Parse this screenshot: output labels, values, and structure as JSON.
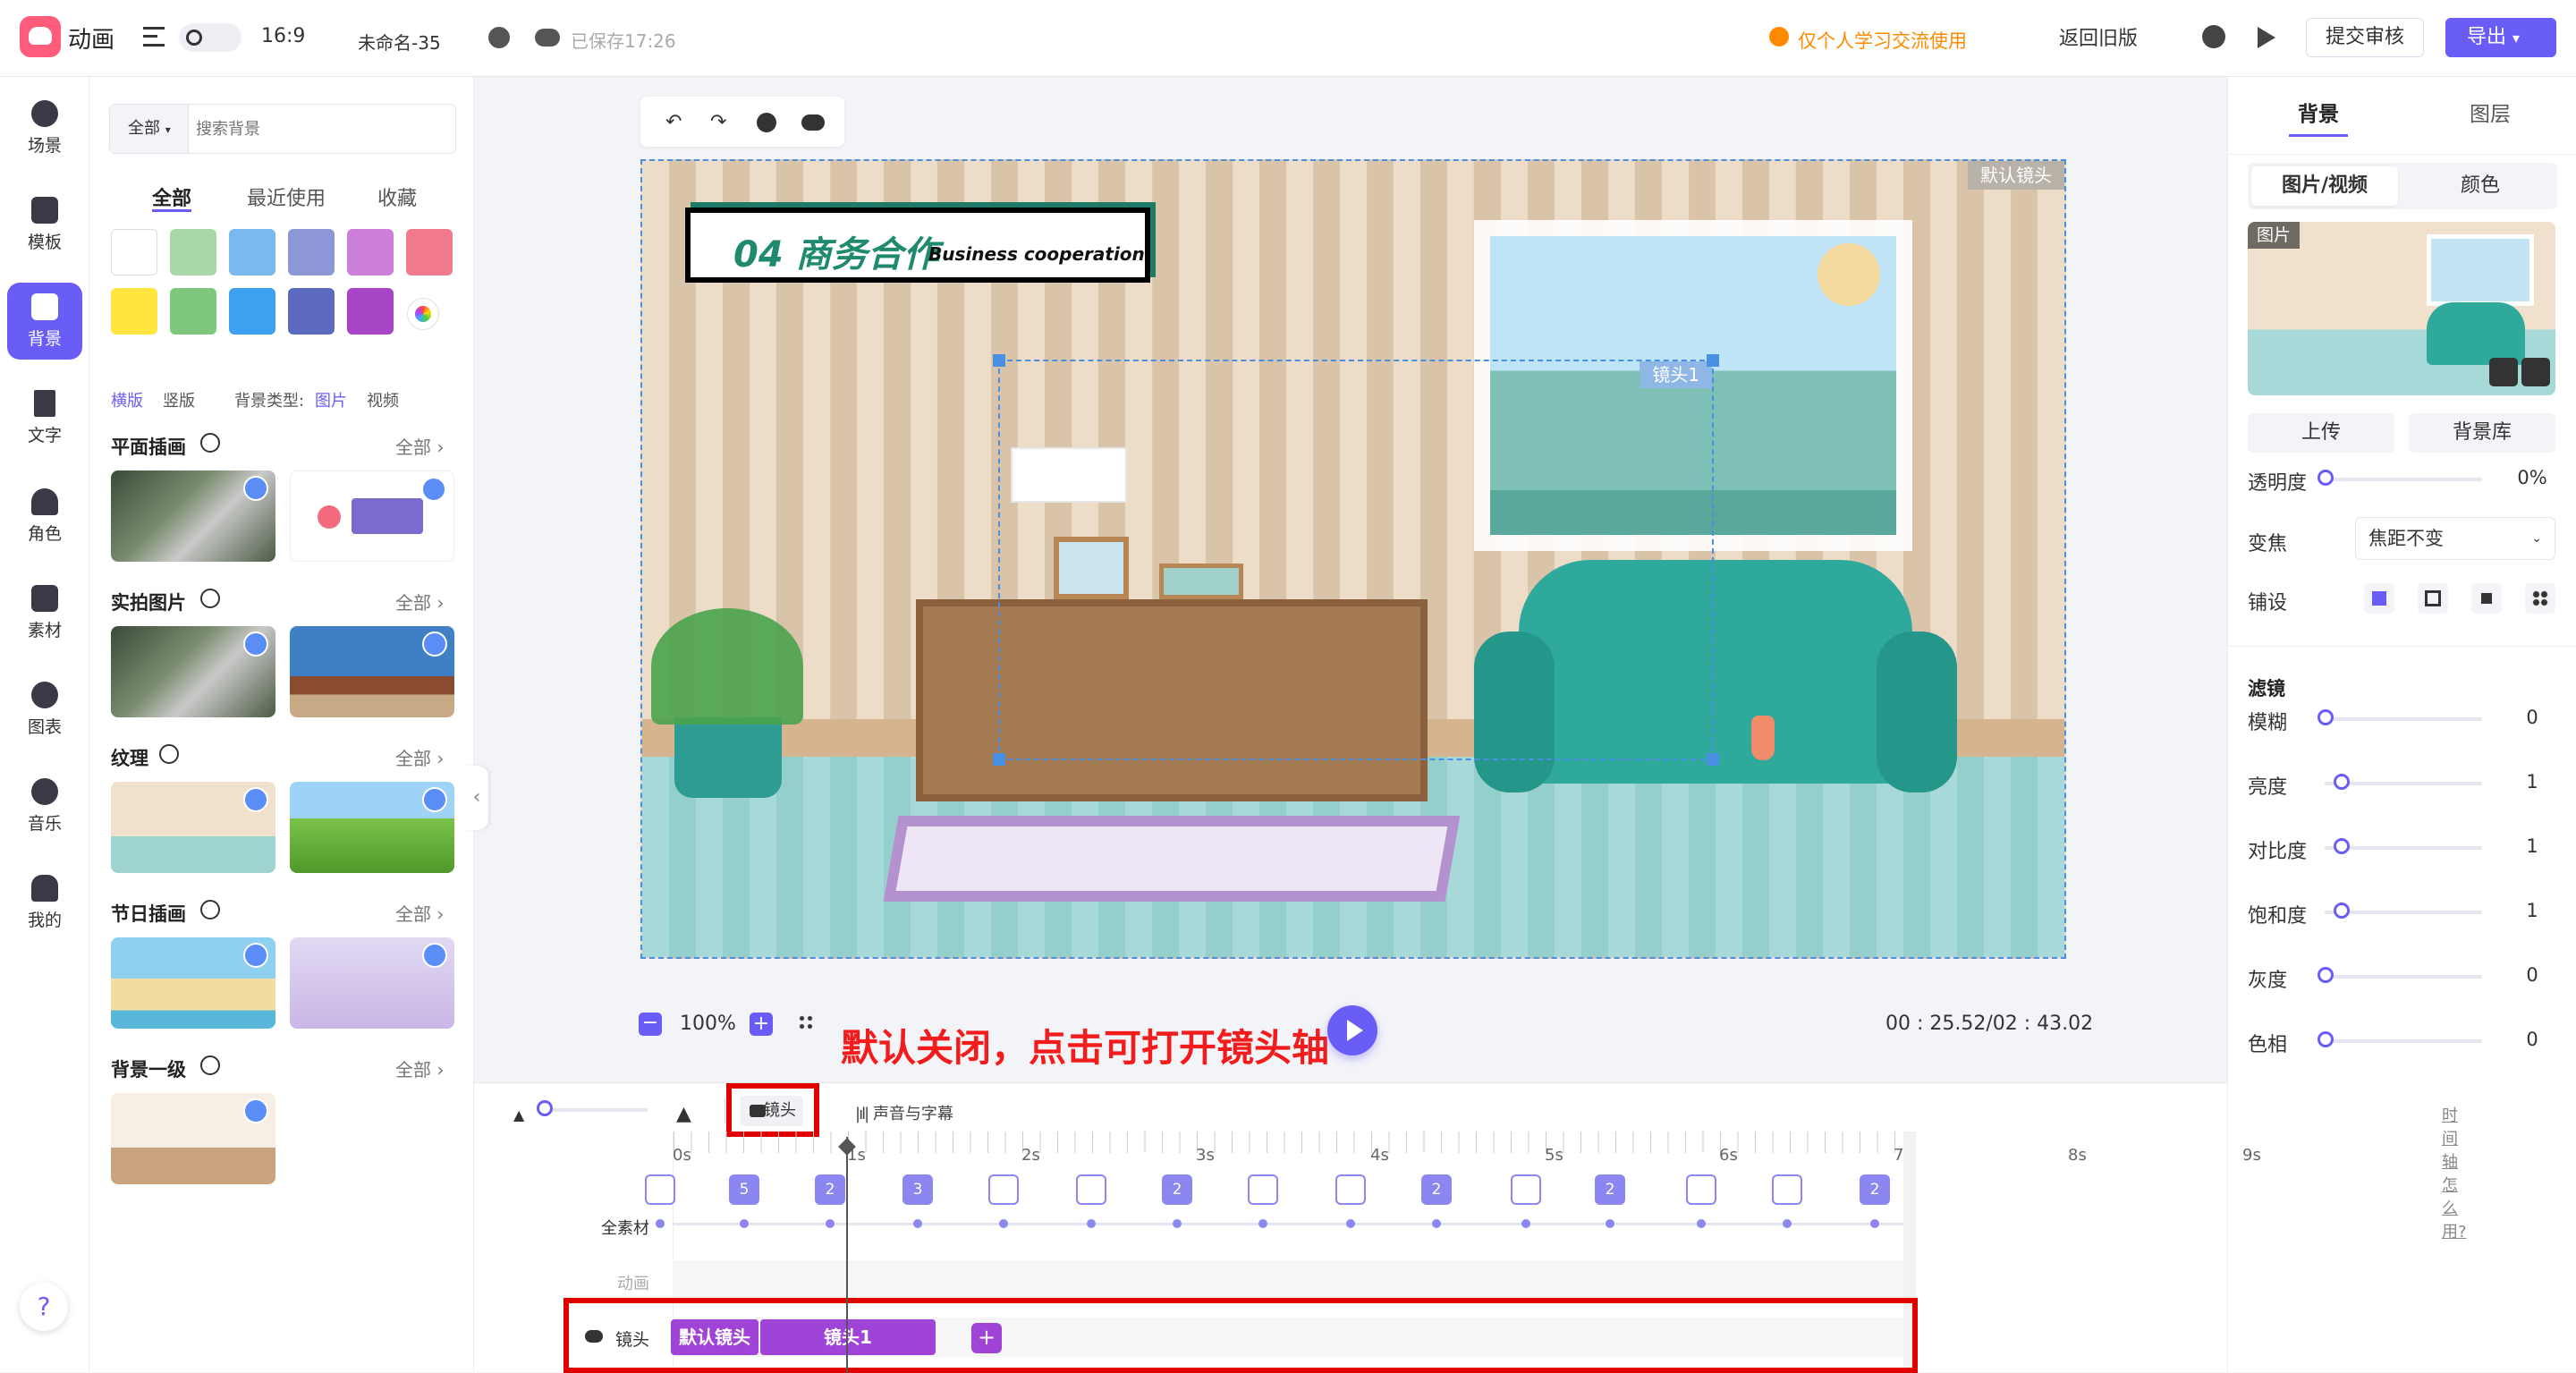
{
  "app": {
    "name": "动画",
    "aspect": "16:9",
    "doc_name": "未命名-35",
    "saved_text": "已保存17:26"
  },
  "header": {
    "notice": "仅个人学习交流使用",
    "back_old": "返回旧版",
    "submit": "提交审核",
    "export": "导出",
    "accent": "#6a5cf6",
    "notice_color": "#ff8a00"
  },
  "nav": [
    {
      "label": "场景",
      "icon": "scene-icon"
    },
    {
      "label": "模板",
      "icon": "template-icon"
    },
    {
      "label": "背景",
      "icon": "background-icon"
    },
    {
      "label": "文字",
      "icon": "text-icon"
    },
    {
      "label": "角色",
      "icon": "character-icon"
    },
    {
      "label": "素材",
      "icon": "material-icon"
    },
    {
      "label": "图表",
      "icon": "chart-icon"
    },
    {
      "label": "音乐",
      "icon": "music-icon"
    },
    {
      "label": "我的",
      "icon": "mine-icon"
    }
  ],
  "help": "?",
  "panel": {
    "filter": "全部",
    "search_placeholder": "搜索背景",
    "tabs": [
      "全部",
      "最近使用",
      "收藏"
    ],
    "colors": [
      "#ffffff",
      "#a8d8a8",
      "#7ab8f0",
      "#8e97d6",
      "#cc7fd9",
      "#f07a8c",
      "#ffe53d",
      "#7ec87e",
      "#3da0f0",
      "#5c6bc0",
      "#a844c6"
    ],
    "orient_h": "横版",
    "orient_v": "竖版",
    "type_label": "背景类型:",
    "type_img": "图片",
    "type_video": "视频",
    "sections": [
      "平面插画",
      "实拍图片",
      "纹理",
      "节日插画",
      "背景一级"
    ],
    "all": "全部"
  },
  "canvas": {
    "default_lens": "默认镜头",
    "lens1": "镜头1",
    "title_main": "04 商务合作",
    "title_sub": "Business cooperation",
    "zoom": "100%",
    "time": "00 : 25.52/02 : 43.02",
    "annotation": "默认关闭，点击可打开镜头轴"
  },
  "right": {
    "tabs": [
      "背景",
      "图层"
    ],
    "subtabs": [
      "图片/视频",
      "颜色"
    ],
    "img_tag": "图片",
    "upload": "上传",
    "library": "背景库",
    "opacity_label": "透明度",
    "opacity_val": "0%",
    "focus_label": "变焦",
    "focus_val": "焦距不变",
    "tile_label": "铺设",
    "filter_title": "滤镜",
    "filters": [
      {
        "label": "模糊",
        "value": "0"
      },
      {
        "label": "亮度",
        "value": "1"
      },
      {
        "label": "对比度",
        "value": "1"
      },
      {
        "label": "饱和度",
        "value": "1"
      },
      {
        "label": "灰度",
        "value": "0"
      },
      {
        "label": "色相",
        "value": "0"
      }
    ]
  },
  "timeline": {
    "lens_btn": "镜头",
    "sound_btn": "声音与字幕",
    "help_link": "时间轴怎么用?",
    "ticks": [
      "0s",
      "1s",
      "2s",
      "3s",
      "4s",
      "5s",
      "6s",
      "7s",
      "8s",
      "9s"
    ],
    "row_all": "全素材",
    "row_anim": "动画",
    "row_lens": "镜头",
    "markers": [
      "",
      "5",
      "2",
      "3",
      "",
      "",
      "2",
      "",
      "",
      "2",
      "",
      "2",
      "",
      "",
      "2"
    ],
    "default_pill": "默认镜头",
    "lens1_pill": "镜头1",
    "add": "+"
  }
}
